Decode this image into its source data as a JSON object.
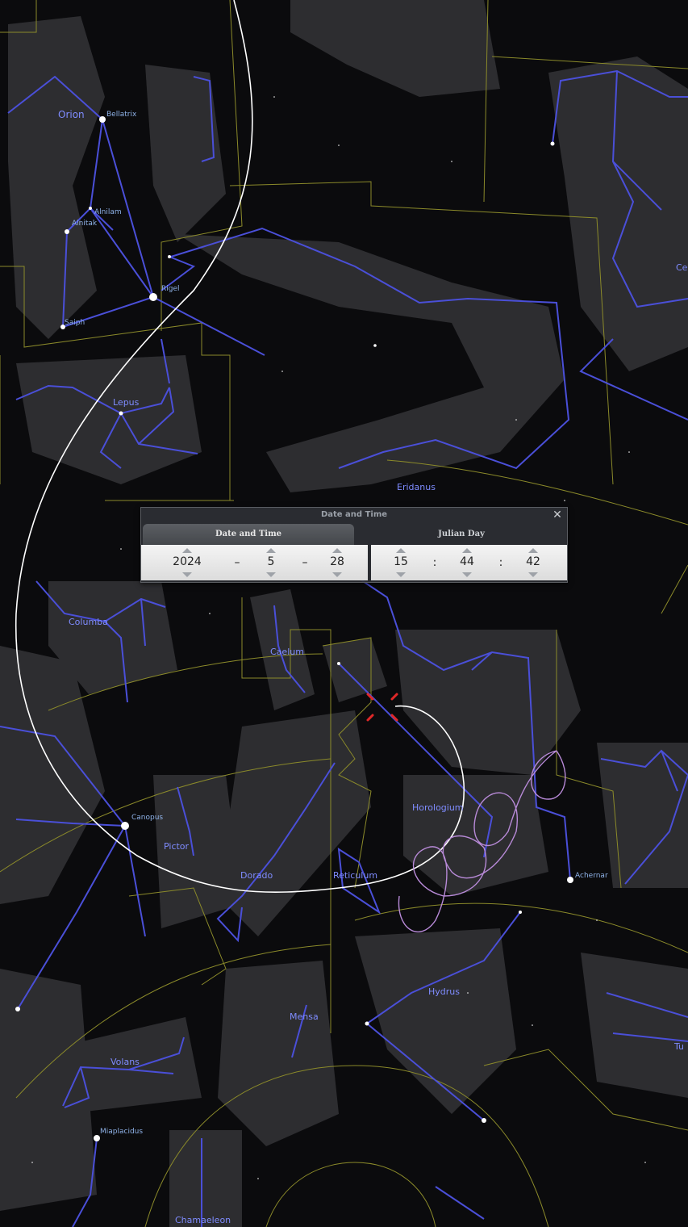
{
  "dialog": {
    "title": "Date and Time",
    "tabs": [
      {
        "label": "Date and Time",
        "active": true
      },
      {
        "label": "Julian Day",
        "active": false
      }
    ],
    "date": {
      "year": "2024",
      "month": "5",
      "day": "28",
      "separator": "–"
    },
    "time": {
      "hour": "15",
      "minute": "44",
      "second": "42",
      "separator": ":"
    },
    "close_icon": "close-icon"
  },
  "constellations": {
    "orion": "Orion",
    "lepus": "Lepus",
    "eridanus": "Eridanus",
    "columba": "Columba",
    "caelum": "Caelum",
    "horologium": "Horologium",
    "pictor": "Pictor",
    "dorado": "Dorado",
    "reticulum": "Reticulum",
    "hydrus": "Hydrus",
    "mensa": "Mensa",
    "volans": "Volans",
    "chamaeleon": "Chamaeleon",
    "cetus": "Ce",
    "tucana": "Tu"
  },
  "stars": {
    "bellatrix": "Bellatrix",
    "alnilam": "Alnilam",
    "alnitak": "Alnitak",
    "rigel": "Rigel",
    "saiph": "Saiph",
    "canopus": "Canopus",
    "achernar": "Achernar",
    "miaplacidus": "Miaplacidus"
  },
  "colors": {
    "sky": "#0b0b0d",
    "constellation_line": "#4a4fd8",
    "boundary": "#8b8a2a",
    "label": "#7f8cff",
    "ecliptic": "#ffffff",
    "planet_path": "#b88ad8",
    "marker": "#e02828"
  }
}
